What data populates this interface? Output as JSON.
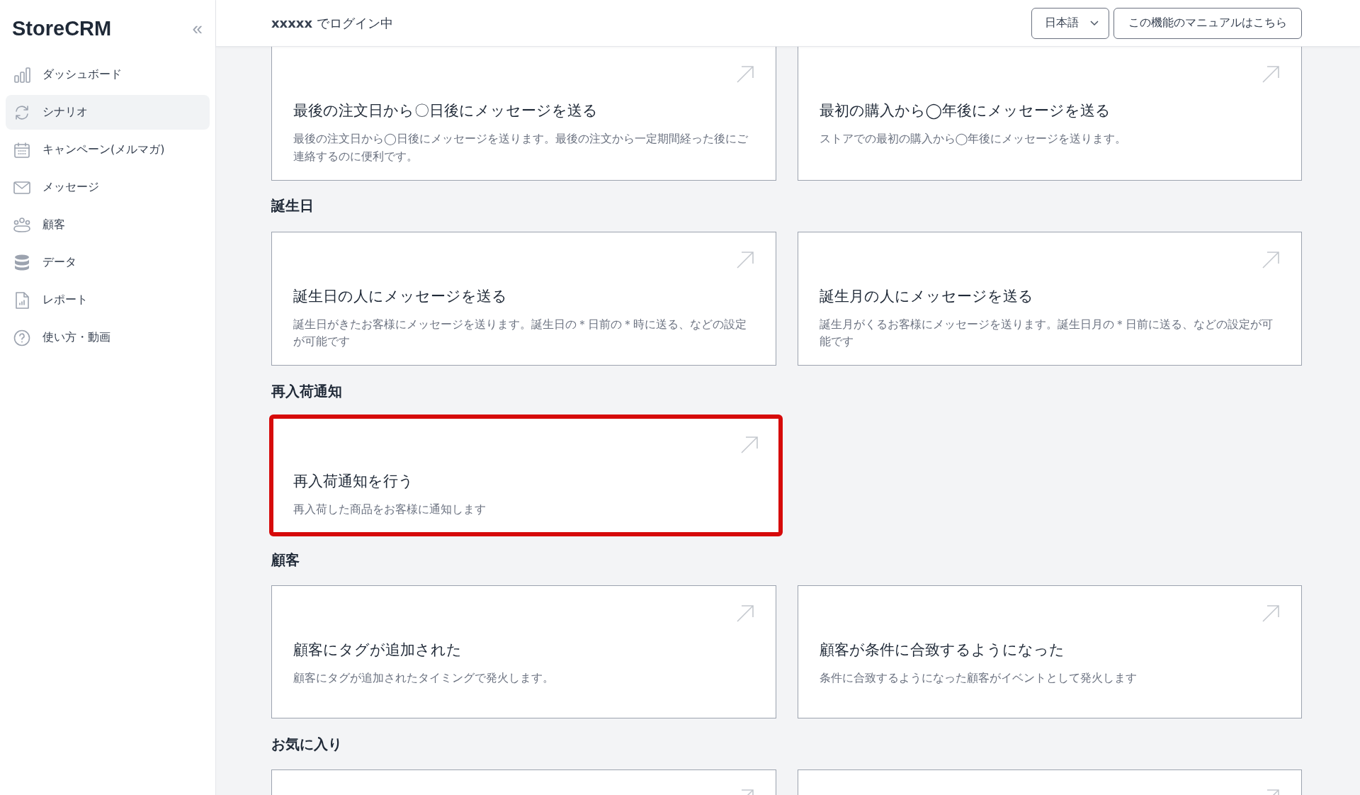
{
  "sidebar": {
    "logo": "StoreCRM",
    "collapse_icon": "«",
    "items": [
      {
        "label": "ダッシュボード",
        "kind": "chart",
        "selected": false
      },
      {
        "label": "シナリオ",
        "kind": "cycle",
        "selected": true
      },
      {
        "label": "キャンペーン(メルマガ)",
        "kind": "calendar",
        "selected": false
      },
      {
        "label": "メッセージ",
        "kind": "mail",
        "selected": false
      },
      {
        "label": "顧客",
        "kind": "people",
        "selected": false
      },
      {
        "label": "データ",
        "kind": "database",
        "selected": false
      },
      {
        "label": "レポート",
        "kind": "report",
        "selected": false
      },
      {
        "label": "使い方・動画",
        "kind": "help",
        "selected": false
      }
    ]
  },
  "header": {
    "login_text": "**xxxxx** でログイン中",
    "language": "日本語",
    "manual_button": "この機能のマニュアルはこちら"
  },
  "sections": [
    {
      "cards": [
        {
          "title": "最後の注文日から〇日後にメッセージを送る",
          "description": "最後の注文日から◯日後にメッセージを送ります。最後の注文から一定期間経った後にご連絡するのに便利です。",
          "highlighted": false
        },
        {
          "title": "最初の購入から◯年後にメッセージを送る",
          "description": "ストアでの最初の購入から◯年後にメッセージを送ります。",
          "highlighted": false
        }
      ]
    },
    {
      "heading": "誕生日",
      "cards": [
        {
          "title": "誕生日の人にメッセージを送る",
          "description": "誕生日がきたお客様にメッセージを送ります。誕生日の＊日前の＊時に送る、などの設定が可能です",
          "highlighted": false
        },
        {
          "title": "誕生月の人にメッセージを送る",
          "description": "誕生月がくるお客様にメッセージを送ります。誕生日月の＊日前に送る、などの設定が可能です",
          "highlighted": false
        }
      ]
    },
    {
      "heading": "再入荷通知",
      "cards": [
        {
          "title": "再入荷通知を行う",
          "description": "再入荷した商品をお客様に通知します",
          "highlighted": true
        }
      ]
    },
    {
      "heading": "顧客",
      "cards": [
        {
          "title": "顧客にタグが追加された",
          "description": "顧客にタグが追加されたタイミングで発火します。",
          "highlighted": false
        },
        {
          "title": "顧客が条件に合致するようになった",
          "description": "条件に合致するようになった顧客がイベントとして発火します",
          "highlighted": false
        }
      ]
    },
    {
      "heading": "お気に入り",
      "cards": [
        {
          "highlighted": false
        },
        {
          "highlighted": false
        }
      ]
    }
  ]
}
